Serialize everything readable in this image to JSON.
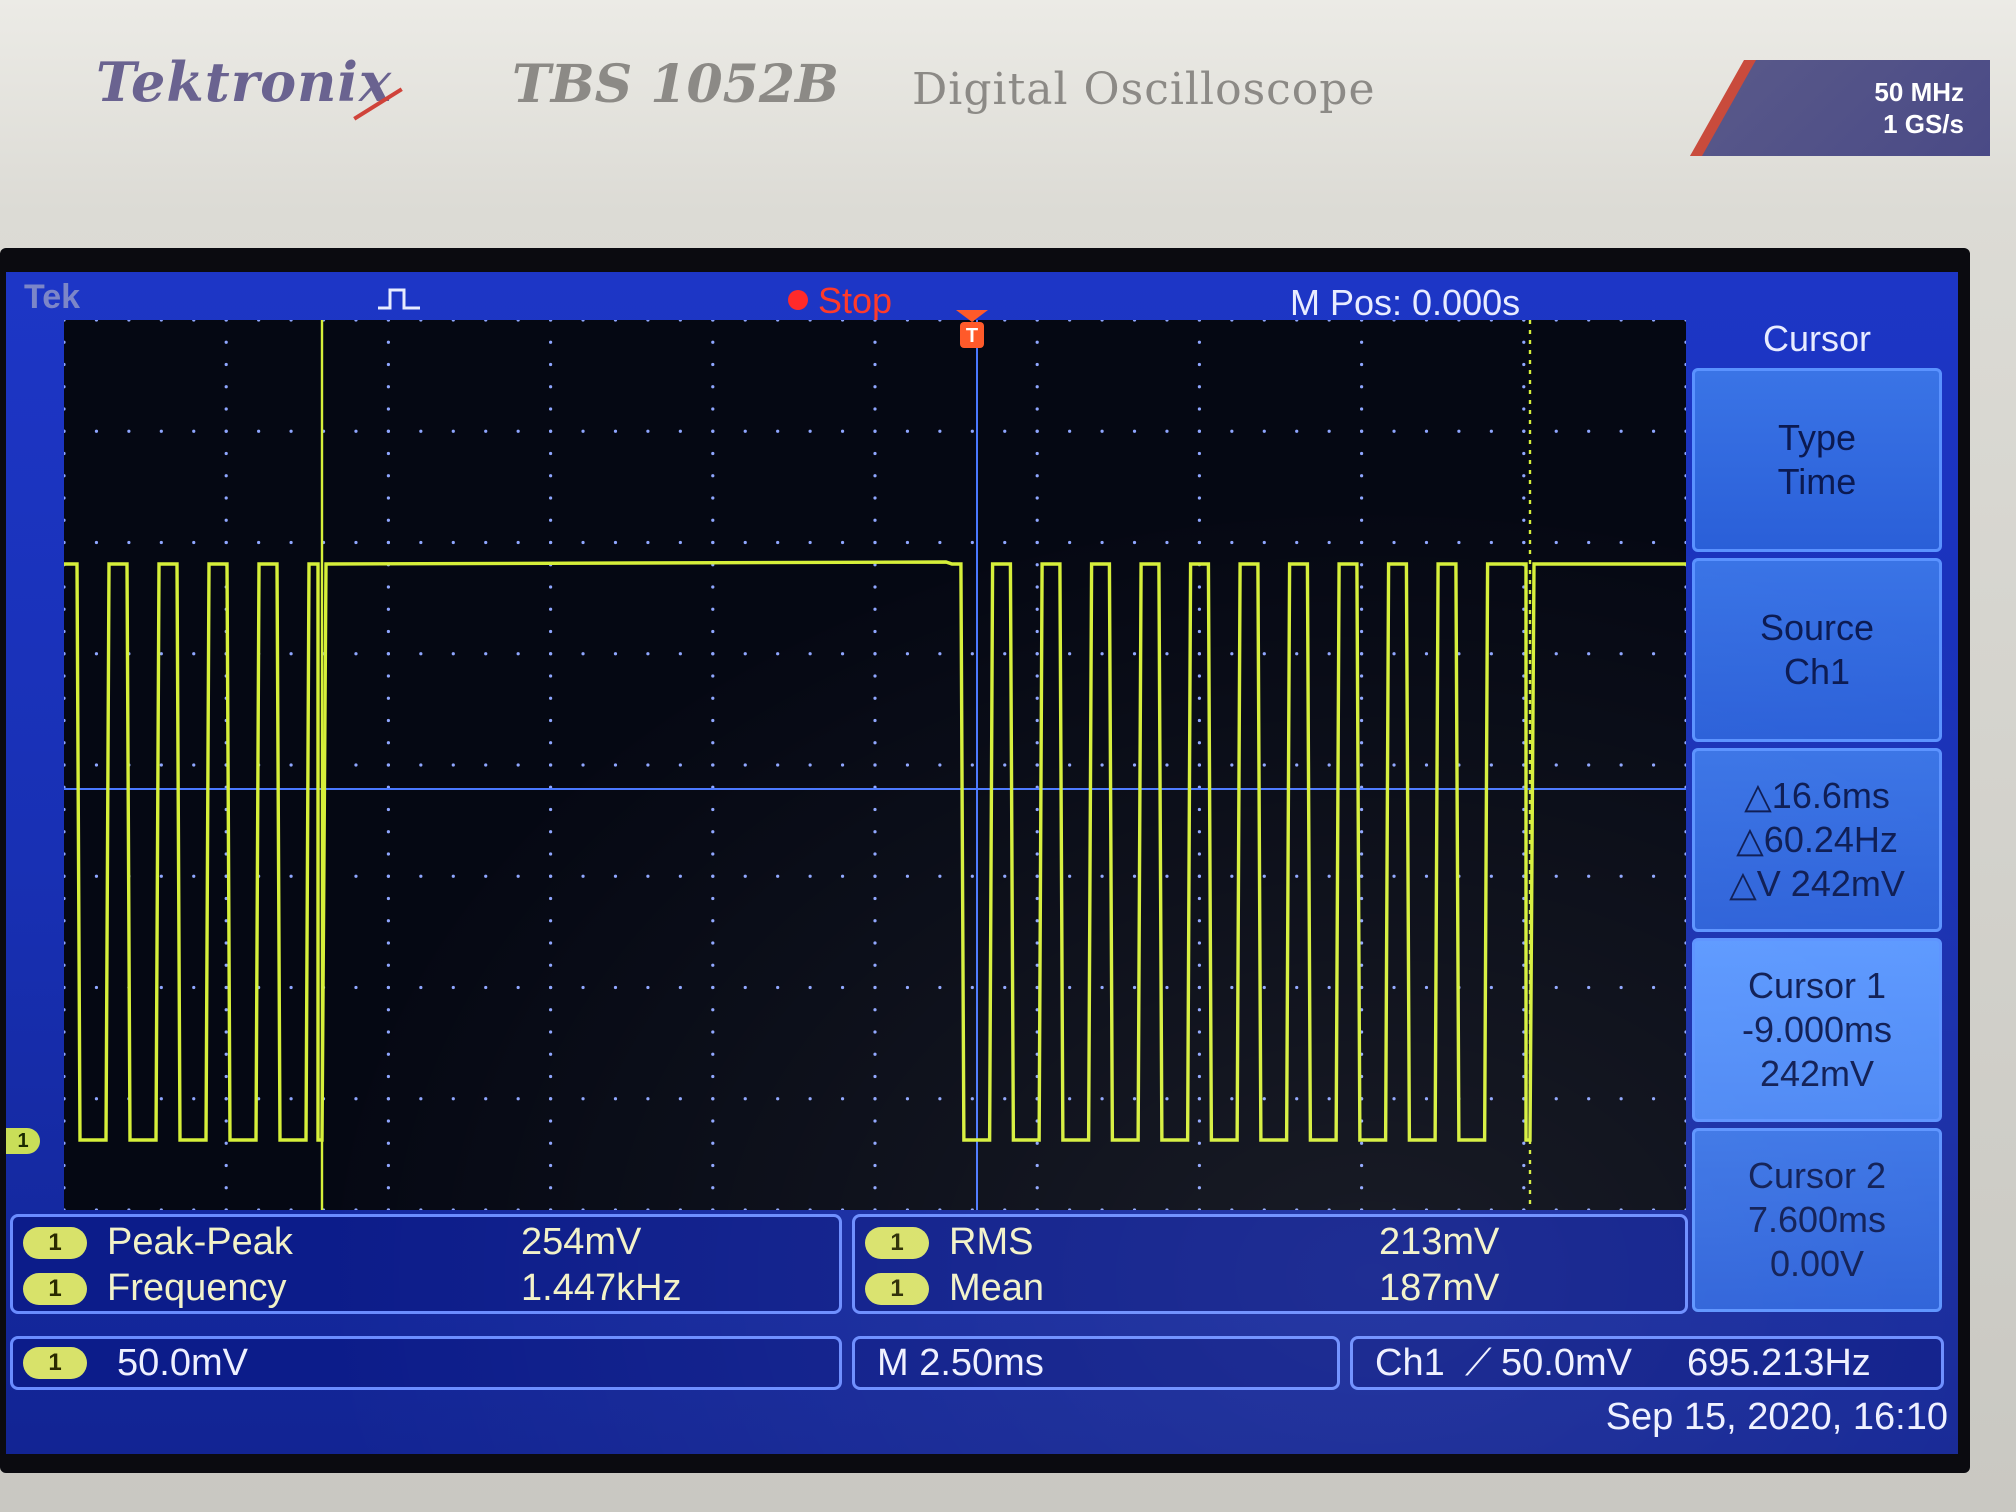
{
  "device": {
    "brand": "Tektronix",
    "model": "TBS 1052B",
    "description": "Digital Oscilloscope",
    "spec_bandwidth": "50 MHz",
    "spec_sample_rate": "1 GS/s"
  },
  "status": {
    "logo": "Tek",
    "trigger_icon": "trigger-pulse-icon",
    "run_state": "Stop",
    "horizontal_position": "M Pos: 0.000s"
  },
  "colors": {
    "trace": "#d6ef3a",
    "cursor": "#4a78ff",
    "screen_bg": "#1a2fa8",
    "stop": "#ff2a2a"
  },
  "menu": {
    "title": "Cursor",
    "buttons": [
      {
        "lines": [
          "Type",
          "Time"
        ]
      },
      {
        "lines": [
          "Source",
          "Ch1"
        ]
      },
      {
        "lines": [
          "△16.6ms",
          "△60.24Hz",
          "△V 242mV"
        ]
      },
      {
        "lines": [
          "Cursor 1",
          "-9.000ms",
          "242mV"
        ]
      },
      {
        "lines": [
          "Cursor 2",
          "7.600ms",
          "0.00V"
        ]
      }
    ]
  },
  "measurements": {
    "left": [
      {
        "channel": "1",
        "label": "Peak-Peak",
        "value": "254mV"
      },
      {
        "channel": "1",
        "label": "Frequency",
        "value": "1.447kHz"
      }
    ],
    "right": [
      {
        "channel": "1",
        "label": "RMS",
        "value": "213mV"
      },
      {
        "channel": "1",
        "label": "Mean",
        "value": "187mV"
      }
    ]
  },
  "bottom": {
    "channel_badge": "1",
    "vertical_scale": "50.0mV",
    "timebase": "M 2.50ms",
    "trigger_source": "Ch1",
    "trigger_slope": "⟋",
    "trigger_level": "50.0mV",
    "trigger_frequency": "695.213Hz",
    "datetime": "Sep 15, 2020, 16:10"
  },
  "ch1_marker": "1",
  "trigger_marker": "T"
}
